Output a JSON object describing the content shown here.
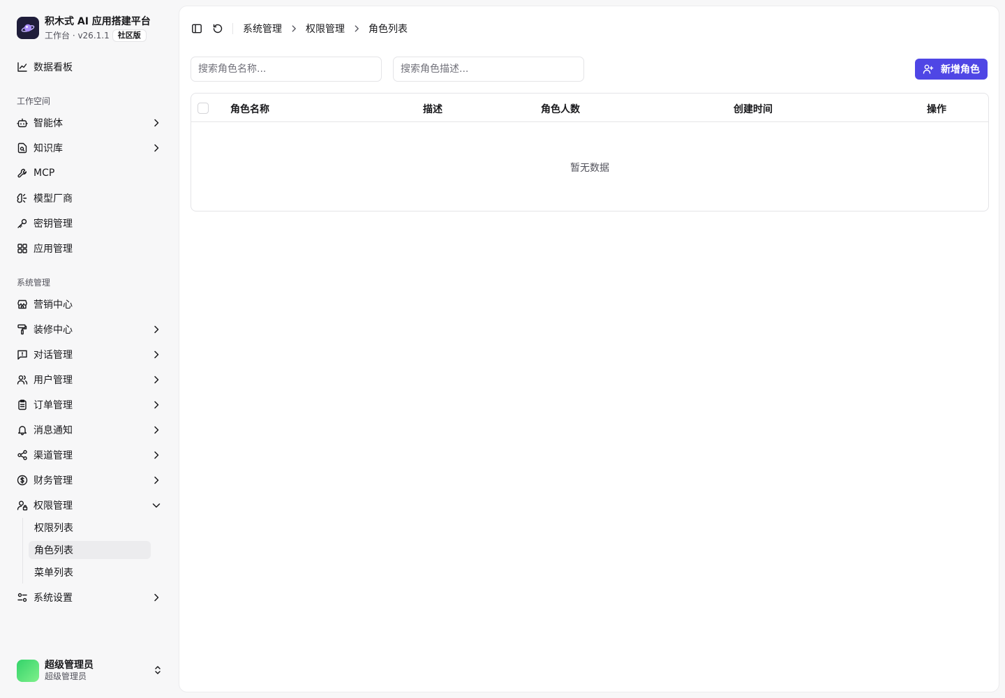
{
  "brand": {
    "title": "积木式 AI 应用搭建平台",
    "subtitle": "工作台 · v26.1.1",
    "badge": "社区版"
  },
  "sidebar": {
    "dashboard": "数据看板",
    "workspace_section": "工作空间",
    "workspace_items": [
      {
        "label": "智能体",
        "icon": "bot-icon",
        "has_children": true
      },
      {
        "label": "知识库",
        "icon": "file-search-icon",
        "has_children": true
      },
      {
        "label": "MCP",
        "icon": "wrench-icon",
        "has_children": false
      },
      {
        "label": "模型厂商",
        "icon": "brain-icon",
        "has_children": false
      },
      {
        "label": "密钥管理",
        "icon": "key-icon",
        "has_children": false
      },
      {
        "label": "应用管理",
        "icon": "grid-icon",
        "has_children": false
      }
    ],
    "system_section": "系统管理",
    "system_items": [
      {
        "label": "营销中心",
        "icon": "store-icon",
        "has_children": false
      },
      {
        "label": "装修中心",
        "icon": "paint-roller-icon",
        "has_children": true
      },
      {
        "label": "对话管理",
        "icon": "message-square-icon",
        "has_children": true
      },
      {
        "label": "用户管理",
        "icon": "users-icon",
        "has_children": true
      },
      {
        "label": "订单管理",
        "icon": "clipboard-icon",
        "has_children": true
      },
      {
        "label": "消息通知",
        "icon": "bell-icon",
        "has_children": true
      },
      {
        "label": "渠道管理",
        "icon": "share-icon",
        "has_children": true
      },
      {
        "label": "财务管理",
        "icon": "dollar-circle-icon",
        "has_children": true
      },
      {
        "label": "权限管理",
        "icon": "user-lock-icon",
        "has_children": true,
        "expanded": true
      }
    ],
    "permission_children": [
      "权限列表",
      "角色列表",
      "菜单列表"
    ],
    "active_child": "角色列表",
    "settings": "系统设置"
  },
  "user": {
    "name": "超级管理员",
    "role": "超级管理员"
  },
  "breadcrumb": [
    "系统管理",
    "权限管理",
    "角色列表"
  ],
  "filters": {
    "name_placeholder": "搜索角色名称...",
    "desc_placeholder": "搜索角色描述..."
  },
  "add_button": "新增角色",
  "table": {
    "columns": [
      "角色名称",
      "描述",
      "角色人数",
      "创建时间",
      "操作"
    ],
    "rows": [],
    "empty_text": "暂无数据"
  },
  "colors": {
    "accent": "#4f46e5",
    "sidebar_bg": "#f7f7f8",
    "active_item_bg": "#ececee"
  }
}
